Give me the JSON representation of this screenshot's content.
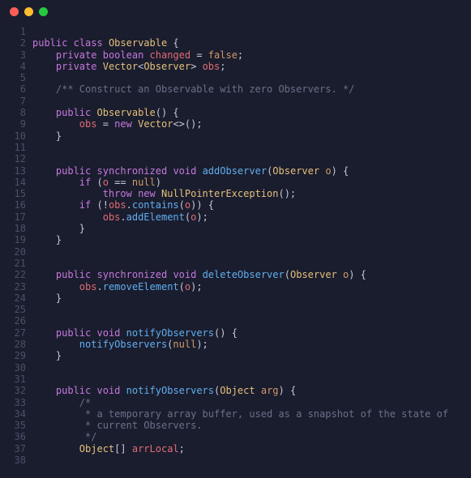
{
  "window": {
    "dots": [
      "red",
      "yellow",
      "green"
    ]
  },
  "lines": [
    "",
    "public class Observable {",
    "    private boolean changed = false;",
    "    private Vector<Observer> obs;",
    "",
    "    /** Construct an Observable with zero Observers. */",
    "",
    "    public Observable() {",
    "        obs = new Vector<>();",
    "    }",
    "",
    "",
    "    public synchronized void addObserver(Observer o) {",
    "        if (o == null)",
    "            throw new NullPointerException();",
    "        if (!obs.contains(o)) {",
    "            obs.addElement(o);",
    "        }",
    "    }",
    "",
    "",
    "    public synchronized void deleteObserver(Observer o) {",
    "        obs.removeElement(o);",
    "    }",
    "",
    "",
    "    public void notifyObservers() {",
    "        notifyObservers(null);",
    "    }",
    "",
    "",
    "    public void notifyObservers(Object arg) {",
    "        /*",
    "         * a temporary array buffer, used as a snapshot of the state of",
    "         * current Observers.",
    "         */",
    "        Object[] arrLocal;",
    ""
  ],
  "tokens": [
    [],
    [
      [
        "kw",
        "public"
      ],
      [
        "op",
        " "
      ],
      [
        "kw",
        "class"
      ],
      [
        "op",
        " "
      ],
      [
        "type",
        "Observable"
      ],
      [
        "op",
        " {"
      ]
    ],
    [
      [
        "op",
        "    "
      ],
      [
        "kw",
        "private"
      ],
      [
        "op",
        " "
      ],
      [
        "kw",
        "boolean"
      ],
      [
        "op",
        " "
      ],
      [
        "var",
        "changed"
      ],
      [
        "op",
        " = "
      ],
      [
        "str",
        "false"
      ],
      [
        "op",
        ";"
      ]
    ],
    [
      [
        "op",
        "    "
      ],
      [
        "kw",
        "private"
      ],
      [
        "op",
        " "
      ],
      [
        "type",
        "Vector"
      ],
      [
        "op",
        "<"
      ],
      [
        "type",
        "Observer"
      ],
      [
        "op",
        "> "
      ],
      [
        "var",
        "obs"
      ],
      [
        "op",
        ";"
      ]
    ],
    [],
    [
      [
        "op",
        "    "
      ],
      [
        "cmt",
        "/** Construct an Observable with zero Observers. */"
      ]
    ],
    [],
    [
      [
        "op",
        "    "
      ],
      [
        "kw",
        "public"
      ],
      [
        "op",
        " "
      ],
      [
        "type",
        "Observable"
      ],
      [
        "op",
        "() {"
      ]
    ],
    [
      [
        "op",
        "        "
      ],
      [
        "var",
        "obs"
      ],
      [
        "op",
        " = "
      ],
      [
        "kw",
        "new"
      ],
      [
        "op",
        " "
      ],
      [
        "type",
        "Vector"
      ],
      [
        "op",
        "<>();"
      ]
    ],
    [
      [
        "op",
        "    }"
      ]
    ],
    [],
    [],
    [
      [
        "op",
        "    "
      ],
      [
        "kw",
        "public"
      ],
      [
        "op",
        " "
      ],
      [
        "kw",
        "synchronized"
      ],
      [
        "op",
        " "
      ],
      [
        "kw",
        "void"
      ],
      [
        "op",
        " "
      ],
      [
        "fn",
        "addObserver"
      ],
      [
        "op",
        "("
      ],
      [
        "type",
        "Observer"
      ],
      [
        "op",
        " "
      ],
      [
        "par",
        "o"
      ],
      [
        "op",
        ") {"
      ]
    ],
    [
      [
        "op",
        "        "
      ],
      [
        "kw",
        "if"
      ],
      [
        "op",
        " ("
      ],
      [
        "var",
        "o"
      ],
      [
        "op",
        " == "
      ],
      [
        "str",
        "null"
      ],
      [
        "op",
        ")"
      ]
    ],
    [
      [
        "op",
        "            "
      ],
      [
        "kw",
        "throw"
      ],
      [
        "op",
        " "
      ],
      [
        "kw",
        "new"
      ],
      [
        "op",
        " "
      ],
      [
        "type",
        "NullPointerException"
      ],
      [
        "op",
        "();"
      ]
    ],
    [
      [
        "op",
        "        "
      ],
      [
        "kw",
        "if"
      ],
      [
        "op",
        " (!"
      ],
      [
        "var",
        "obs"
      ],
      [
        "op",
        "."
      ],
      [
        "fn",
        "contains"
      ],
      [
        "op",
        "("
      ],
      [
        "var",
        "o"
      ],
      [
        "op",
        ")) {"
      ]
    ],
    [
      [
        "op",
        "            "
      ],
      [
        "var",
        "obs"
      ],
      [
        "op",
        "."
      ],
      [
        "fn",
        "addElement"
      ],
      [
        "op",
        "("
      ],
      [
        "var",
        "o"
      ],
      [
        "op",
        ");"
      ]
    ],
    [
      [
        "op",
        "        }"
      ]
    ],
    [
      [
        "op",
        "    }"
      ]
    ],
    [],
    [],
    [
      [
        "op",
        "    "
      ],
      [
        "kw",
        "public"
      ],
      [
        "op",
        " "
      ],
      [
        "kw",
        "synchronized"
      ],
      [
        "op",
        " "
      ],
      [
        "kw",
        "void"
      ],
      [
        "op",
        " "
      ],
      [
        "fn",
        "deleteObserver"
      ],
      [
        "op",
        "("
      ],
      [
        "type",
        "Observer"
      ],
      [
        "op",
        " "
      ],
      [
        "par",
        "o"
      ],
      [
        "op",
        ") {"
      ]
    ],
    [
      [
        "op",
        "        "
      ],
      [
        "var",
        "obs"
      ],
      [
        "op",
        "."
      ],
      [
        "fn",
        "removeElement"
      ],
      [
        "op",
        "("
      ],
      [
        "var",
        "o"
      ],
      [
        "op",
        ");"
      ]
    ],
    [
      [
        "op",
        "    }"
      ]
    ],
    [],
    [],
    [
      [
        "op",
        "    "
      ],
      [
        "kw",
        "public"
      ],
      [
        "op",
        " "
      ],
      [
        "kw",
        "void"
      ],
      [
        "op",
        " "
      ],
      [
        "fn",
        "notifyObservers"
      ],
      [
        "op",
        "() {"
      ]
    ],
    [
      [
        "op",
        "        "
      ],
      [
        "fn",
        "notifyObservers"
      ],
      [
        "op",
        "("
      ],
      [
        "str",
        "null"
      ],
      [
        "op",
        ");"
      ]
    ],
    [
      [
        "op",
        "    }"
      ]
    ],
    [],
    [],
    [
      [
        "op",
        "    "
      ],
      [
        "kw",
        "public"
      ],
      [
        "op",
        " "
      ],
      [
        "kw",
        "void"
      ],
      [
        "op",
        " "
      ],
      [
        "fn",
        "notifyObservers"
      ],
      [
        "op",
        "("
      ],
      [
        "type",
        "Object"
      ],
      [
        "op",
        " "
      ],
      [
        "par",
        "arg"
      ],
      [
        "op",
        ") {"
      ]
    ],
    [
      [
        "op",
        "        "
      ],
      [
        "cmt",
        "/*"
      ]
    ],
    [
      [
        "op",
        "         "
      ],
      [
        "cmt",
        "* a temporary array buffer, used as a snapshot of the state of"
      ]
    ],
    [
      [
        "op",
        "         "
      ],
      [
        "cmt",
        "* current Observers."
      ]
    ],
    [
      [
        "op",
        "         "
      ],
      [
        "cmt",
        "*/"
      ]
    ],
    [
      [
        "op",
        "        "
      ],
      [
        "type",
        "Object"
      ],
      [
        "op",
        "[] "
      ],
      [
        "var",
        "arrLocal"
      ],
      [
        "op",
        ";"
      ]
    ],
    []
  ]
}
